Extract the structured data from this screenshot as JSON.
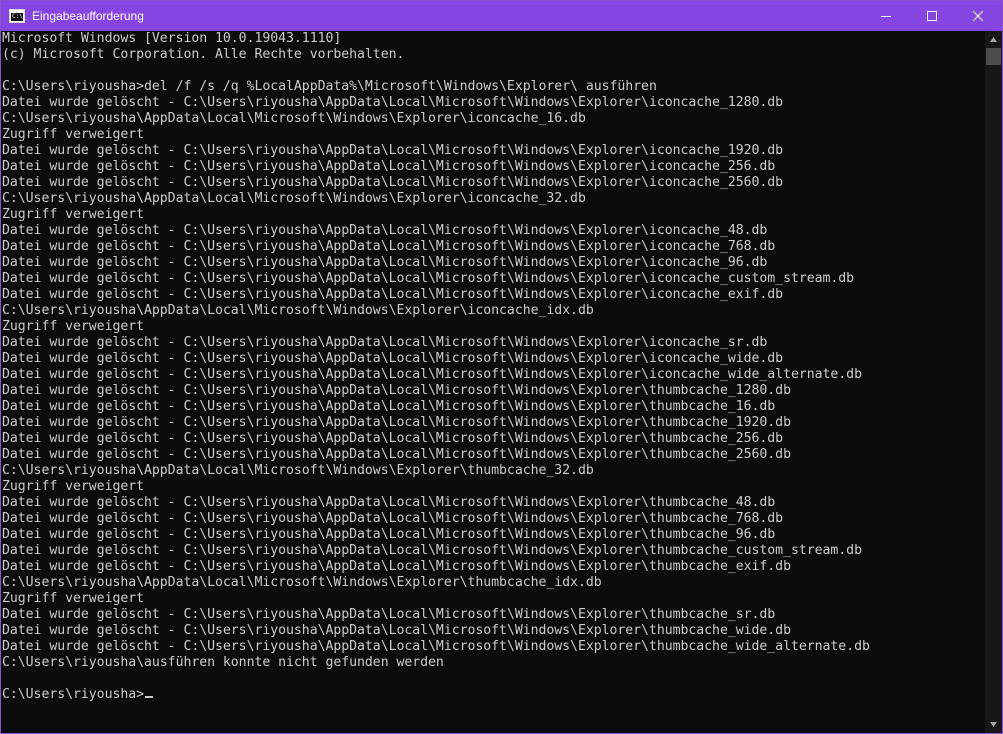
{
  "window": {
    "title": "Eingabeaufforderung",
    "app_icon": "console-icon",
    "app_icon_prompt": "C:\\_",
    "accent_color": "#8644e0",
    "controls": [
      "minimize-icon",
      "maximize-icon",
      "close-icon"
    ]
  },
  "console": {
    "lines": [
      "Microsoft Windows [Version 10.0.19043.1110]",
      "(c) Microsoft Corporation. Alle Rechte vorbehalten.",
      "",
      "C:\\Users\\riyousha>del /f /s /q %LocalAppData%\\Microsoft\\Windows\\Explorer\\ ausführen",
      "Datei wurde gelöscht - C:\\Users\\riyousha\\AppData\\Local\\Microsoft\\Windows\\Explorer\\iconcache_1280.db",
      "C:\\Users\\riyousha\\AppData\\Local\\Microsoft\\Windows\\Explorer\\iconcache_16.db",
      "Zugriff verweigert",
      "Datei wurde gelöscht - C:\\Users\\riyousha\\AppData\\Local\\Microsoft\\Windows\\Explorer\\iconcache_1920.db",
      "Datei wurde gelöscht - C:\\Users\\riyousha\\AppData\\Local\\Microsoft\\Windows\\Explorer\\iconcache_256.db",
      "Datei wurde gelöscht - C:\\Users\\riyousha\\AppData\\Local\\Microsoft\\Windows\\Explorer\\iconcache_2560.db",
      "C:\\Users\\riyousha\\AppData\\Local\\Microsoft\\Windows\\Explorer\\iconcache_32.db",
      "Zugriff verweigert",
      "Datei wurde gelöscht - C:\\Users\\riyousha\\AppData\\Local\\Microsoft\\Windows\\Explorer\\iconcache_48.db",
      "Datei wurde gelöscht - C:\\Users\\riyousha\\AppData\\Local\\Microsoft\\Windows\\Explorer\\iconcache_768.db",
      "Datei wurde gelöscht - C:\\Users\\riyousha\\AppData\\Local\\Microsoft\\Windows\\Explorer\\iconcache_96.db",
      "Datei wurde gelöscht - C:\\Users\\riyousha\\AppData\\Local\\Microsoft\\Windows\\Explorer\\iconcache_custom_stream.db",
      "Datei wurde gelöscht - C:\\Users\\riyousha\\AppData\\Local\\Microsoft\\Windows\\Explorer\\iconcache_exif.db",
      "C:\\Users\\riyousha\\AppData\\Local\\Microsoft\\Windows\\Explorer\\iconcache_idx.db",
      "Zugriff verweigert",
      "Datei wurde gelöscht - C:\\Users\\riyousha\\AppData\\Local\\Microsoft\\Windows\\Explorer\\iconcache_sr.db",
      "Datei wurde gelöscht - C:\\Users\\riyousha\\AppData\\Local\\Microsoft\\Windows\\Explorer\\iconcache_wide.db",
      "Datei wurde gelöscht - C:\\Users\\riyousha\\AppData\\Local\\Microsoft\\Windows\\Explorer\\iconcache_wide_alternate.db",
      "Datei wurde gelöscht - C:\\Users\\riyousha\\AppData\\Local\\Microsoft\\Windows\\Explorer\\thumbcache_1280.db",
      "Datei wurde gelöscht - C:\\Users\\riyousha\\AppData\\Local\\Microsoft\\Windows\\Explorer\\thumbcache_16.db",
      "Datei wurde gelöscht - C:\\Users\\riyousha\\AppData\\Local\\Microsoft\\Windows\\Explorer\\thumbcache_1920.db",
      "Datei wurde gelöscht - C:\\Users\\riyousha\\AppData\\Local\\Microsoft\\Windows\\Explorer\\thumbcache_256.db",
      "Datei wurde gelöscht - C:\\Users\\riyousha\\AppData\\Local\\Microsoft\\Windows\\Explorer\\thumbcache_2560.db",
      "C:\\Users\\riyousha\\AppData\\Local\\Microsoft\\Windows\\Explorer\\thumbcache_32.db",
      "Zugriff verweigert",
      "Datei wurde gelöscht - C:\\Users\\riyousha\\AppData\\Local\\Microsoft\\Windows\\Explorer\\thumbcache_48.db",
      "Datei wurde gelöscht - C:\\Users\\riyousha\\AppData\\Local\\Microsoft\\Windows\\Explorer\\thumbcache_768.db",
      "Datei wurde gelöscht - C:\\Users\\riyousha\\AppData\\Local\\Microsoft\\Windows\\Explorer\\thumbcache_96.db",
      "Datei wurde gelöscht - C:\\Users\\riyousha\\AppData\\Local\\Microsoft\\Windows\\Explorer\\thumbcache_custom_stream.db",
      "Datei wurde gelöscht - C:\\Users\\riyousha\\AppData\\Local\\Microsoft\\Windows\\Explorer\\thumbcache_exif.db",
      "C:\\Users\\riyousha\\AppData\\Local\\Microsoft\\Windows\\Explorer\\thumbcache_idx.db",
      "Zugriff verweigert",
      "Datei wurde gelöscht - C:\\Users\\riyousha\\AppData\\Local\\Microsoft\\Windows\\Explorer\\thumbcache_sr.db",
      "Datei wurde gelöscht - C:\\Users\\riyousha\\AppData\\Local\\Microsoft\\Windows\\Explorer\\thumbcache_wide.db",
      "Datei wurde gelöscht - C:\\Users\\riyousha\\AppData\\Local\\Microsoft\\Windows\\Explorer\\thumbcache_wide_alternate.db",
      "C:\\Users\\riyousha\\ausführen konnte nicht gefunden werden",
      ""
    ],
    "prompt": "C:\\Users\\riyousha>",
    "text_color": "#cccccc",
    "background_color": "#0c0c0c"
  },
  "scrollbar": {
    "up_icon": "scroll-up-arrow-icon",
    "down_icon": "scroll-down-arrow-icon"
  }
}
